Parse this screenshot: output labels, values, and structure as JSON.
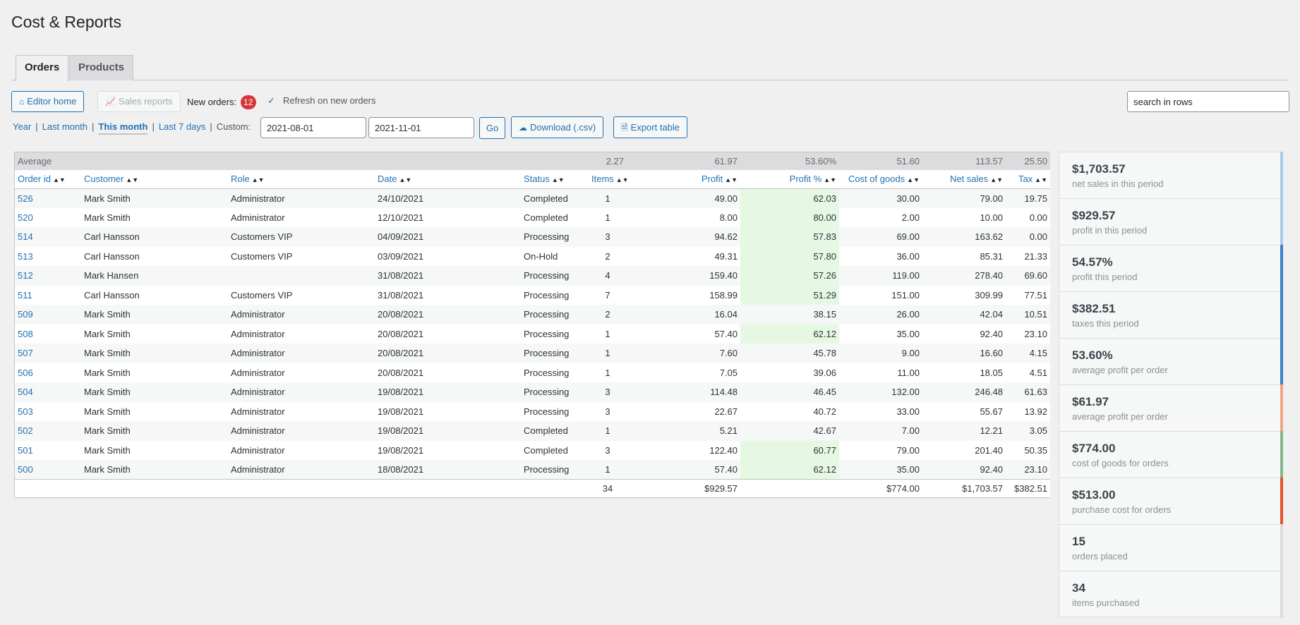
{
  "page": {
    "title": "Cost & Reports"
  },
  "tabs": [
    {
      "label": "Orders"
    },
    {
      "label": "Products"
    }
  ],
  "toolbar": {
    "editor_home": "Editor home",
    "sales_reports": "Sales reports",
    "new_orders_label": "New orders:",
    "new_orders_count": "12",
    "refresh_label": "Refresh on new orders",
    "search_placeholder": "search in rows"
  },
  "periods": {
    "year": "Year",
    "last_month": "Last month",
    "this_month": "This month",
    "last_7_days": "Last 7 days",
    "custom_label": "Custom:",
    "date_from": "2021-08-01",
    "date_to": "2021-11-01",
    "go": "Go",
    "download": "Download (.csv)",
    "export": "Export table"
  },
  "table": {
    "average_label": "Average",
    "averages": {
      "items": "2.27",
      "profit": "61.97",
      "profit_pct": "53.60%",
      "cost": "51.60",
      "net": "113.57",
      "tax": "25.50"
    },
    "columns": [
      "Order id",
      "Customer",
      "Role",
      "Date",
      "Status",
      "Items",
      "Profit",
      "Profit %",
      "Cost of goods",
      "Net sales",
      "Tax"
    ],
    "rows": [
      {
        "id": "526",
        "customer": "Mark Smith",
        "role": "Administrator",
        "date": "24/10/2021",
        "status": "Completed",
        "items": "1",
        "profit": "49.00",
        "pct": "62.03",
        "cost": "30.00",
        "net": "79.00",
        "tax": "19.75",
        "hi": true
      },
      {
        "id": "520",
        "customer": "Mark Smith",
        "role": "Administrator",
        "date": "12/10/2021",
        "status": "Completed",
        "items": "1",
        "profit": "8.00",
        "pct": "80.00",
        "cost": "2.00",
        "net": "10.00",
        "tax": "0.00",
        "hi": true
      },
      {
        "id": "514",
        "customer": "Carl Hansson",
        "role": "Customers VIP",
        "date": "04/09/2021",
        "status": "Processing",
        "items": "3",
        "profit": "94.62",
        "pct": "57.83",
        "cost": "69.00",
        "net": "163.62",
        "tax": "0.00",
        "hi": true
      },
      {
        "id": "513",
        "customer": "Carl Hansson",
        "role": "Customers VIP",
        "date": "03/09/2021",
        "status": "On-Hold",
        "items": "2",
        "profit": "49.31",
        "pct": "57.80",
        "cost": "36.00",
        "net": "85.31",
        "tax": "21.33",
        "hi": true
      },
      {
        "id": "512",
        "customer": "Mark Hansen",
        "role": "",
        "date": "31/08/2021",
        "status": "Processing",
        "items": "4",
        "profit": "159.40",
        "pct": "57.26",
        "cost": "119.00",
        "net": "278.40",
        "tax": "69.60",
        "hi": true
      },
      {
        "id": "511",
        "customer": "Carl Hansson",
        "role": "Customers VIP",
        "date": "31/08/2021",
        "status": "Processing",
        "items": "7",
        "profit": "158.99",
        "pct": "51.29",
        "cost": "151.00",
        "net": "309.99",
        "tax": "77.51",
        "hi": true
      },
      {
        "id": "509",
        "customer": "Mark Smith",
        "role": "Administrator",
        "date": "20/08/2021",
        "status": "Processing",
        "items": "2",
        "profit": "16.04",
        "pct": "38.15",
        "cost": "26.00",
        "net": "42.04",
        "tax": "10.51",
        "hi": false
      },
      {
        "id": "508",
        "customer": "Mark Smith",
        "role": "Administrator",
        "date": "20/08/2021",
        "status": "Processing",
        "items": "1",
        "profit": "57.40",
        "pct": "62.12",
        "cost": "35.00",
        "net": "92.40",
        "tax": "23.10",
        "hi": true
      },
      {
        "id": "507",
        "customer": "Mark Smith",
        "role": "Administrator",
        "date": "20/08/2021",
        "status": "Processing",
        "items": "1",
        "profit": "7.60",
        "pct": "45.78",
        "cost": "9.00",
        "net": "16.60",
        "tax": "4.15",
        "hi": false
      },
      {
        "id": "506",
        "customer": "Mark Smith",
        "role": "Administrator",
        "date": "20/08/2021",
        "status": "Processing",
        "items": "1",
        "profit": "7.05",
        "pct": "39.06",
        "cost": "11.00",
        "net": "18.05",
        "tax": "4.51",
        "hi": false
      },
      {
        "id": "504",
        "customer": "Mark Smith",
        "role": "Administrator",
        "date": "19/08/2021",
        "status": "Processing",
        "items": "3",
        "profit": "114.48",
        "pct": "46.45",
        "cost": "132.00",
        "net": "246.48",
        "tax": "61.63",
        "hi": false
      },
      {
        "id": "503",
        "customer": "Mark Smith",
        "role": "Administrator",
        "date": "19/08/2021",
        "status": "Processing",
        "items": "3",
        "profit": "22.67",
        "pct": "40.72",
        "cost": "33.00",
        "net": "55.67",
        "tax": "13.92",
        "hi": false
      },
      {
        "id": "502",
        "customer": "Mark Smith",
        "role": "Administrator",
        "date": "19/08/2021",
        "status": "Completed",
        "items": "1",
        "profit": "5.21",
        "pct": "42.67",
        "cost": "7.00",
        "net": "12.21",
        "tax": "3.05",
        "hi": false
      },
      {
        "id": "501",
        "customer": "Mark Smith",
        "role": "Administrator",
        "date": "19/08/2021",
        "status": "Completed",
        "items": "3",
        "profit": "122.40",
        "pct": "60.77",
        "cost": "79.00",
        "net": "201.40",
        "tax": "50.35",
        "hi": true
      },
      {
        "id": "500",
        "customer": "Mark Smith",
        "role": "Administrator",
        "date": "18/08/2021",
        "status": "Processing",
        "items": "1",
        "profit": "57.40",
        "pct": "62.12",
        "cost": "35.00",
        "net": "92.40",
        "tax": "23.10",
        "hi": true
      }
    ],
    "totals": {
      "items": "34",
      "profit": "$929.57",
      "cost": "$774.00",
      "net": "$1,703.57",
      "tax": "$382.51"
    }
  },
  "summary_cards": [
    {
      "value": "$1,703.57",
      "label": "net sales in this period",
      "color": "#a8cbe8"
    },
    {
      "value": "$929.57",
      "label": "profit in this period",
      "color": "#a8cbe8"
    },
    {
      "value": "54.57%",
      "label": "profit this period",
      "color": "#3582c4"
    },
    {
      "value": "$382.51",
      "label": "taxes this period",
      "color": "#3582c4"
    },
    {
      "value": "53.60%",
      "label": "average profit per order",
      "color": "#3582c4"
    },
    {
      "value": "$61.97",
      "label": "average profit per order",
      "color": "#f2a585"
    },
    {
      "value": "$774.00",
      "label": "cost of goods for orders",
      "color": "#86b686"
    },
    {
      "value": "$513.00",
      "label": "purchase cost for orders",
      "color": "#e65128"
    },
    {
      "value": "15",
      "label": "orders placed",
      "color": "#dcdcde"
    },
    {
      "value": "34",
      "label": "items purchased",
      "color": "#dcdcde"
    }
  ],
  "colors": {
    "accent": "#2271b1",
    "highlight": "#e6f8e3",
    "badge": "#d63638"
  }
}
